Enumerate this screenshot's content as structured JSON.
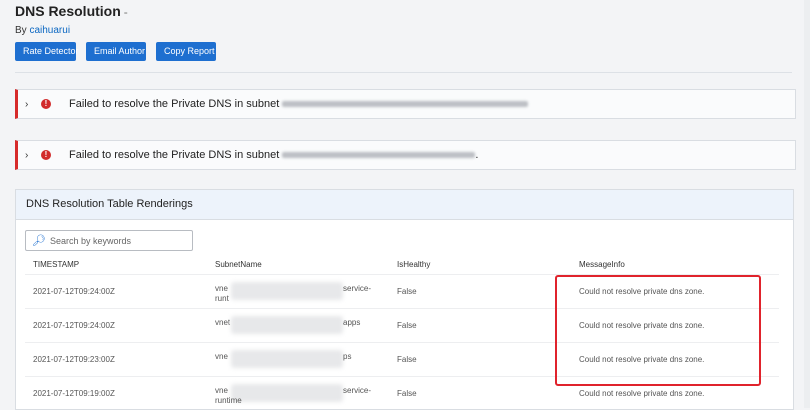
{
  "header": {
    "title": "DNS Resolution",
    "title_suffix": "-",
    "byline_prefix": "By",
    "author": "caihuarui"
  },
  "toolbar": {
    "rate_label": "Rate Detector",
    "email_label": "Email Author",
    "copy_label": "Copy Report"
  },
  "alerts": [
    {
      "chevron": "›",
      "icon": "error-icon",
      "message": "Failed to resolve the Private DNS in subnet",
      "trail": ""
    },
    {
      "chevron": "›",
      "icon": "error-icon",
      "message": "Failed to resolve the Private DNS in subnet",
      "trail": "."
    }
  ],
  "panel": {
    "title": "DNS Resolution Table Renderings",
    "search_placeholder": "Search by keywords"
  },
  "table": {
    "columns": [
      "TIMESTAMP",
      "SubnetName",
      "IsHealthy",
      "MessageInfo"
    ],
    "rows": [
      {
        "timestamp": "2021-07-12T09:24:00Z",
        "subnet_pre": "vne",
        "subnet_post": "service-",
        "subnet_line2": "runt",
        "healthy": "False",
        "message": "Could not resolve private dns zone."
      },
      {
        "timestamp": "2021-07-12T09:24:00Z",
        "subnet_pre": "vnet",
        "subnet_post": "apps",
        "subnet_line2": "",
        "healthy": "False",
        "message": "Could not resolve private dns zone."
      },
      {
        "timestamp": "2021-07-12T09:23:00Z",
        "subnet_pre": "vne",
        "subnet_post": "ps",
        "subnet_line2": "",
        "healthy": "False",
        "message": "Could not resolve private dns zone."
      },
      {
        "timestamp": "2021-07-12T09:19:00Z",
        "subnet_pre": "vne",
        "subnet_post": "service-",
        "subnet_line2": "runtime",
        "healthy": "False",
        "message": "Could not resolve private dns zone."
      }
    ]
  },
  "colors": {
    "accent": "#1e6fd0",
    "error": "#d62a2a",
    "highlight": "#e0232c"
  }
}
